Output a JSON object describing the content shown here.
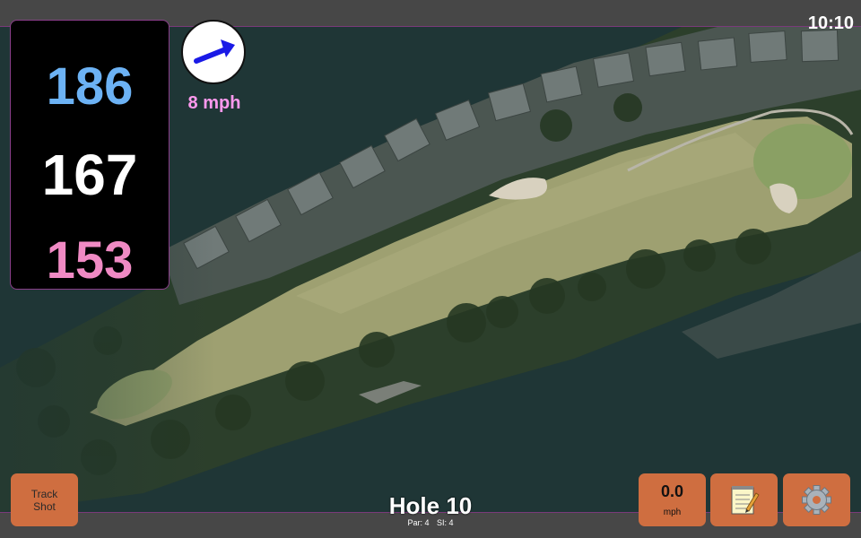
{
  "status_bar": {
    "time": "10:10"
  },
  "distances": {
    "back": "186",
    "center": "167",
    "front": "153"
  },
  "wind": {
    "speed_label": "8 mph",
    "direction": "east-northeast",
    "icon": "wind-arrow-icon"
  },
  "hole": {
    "title": "Hole 10",
    "par_label": "Par: 4",
    "si_label": "SI: 4"
  },
  "buttons": {
    "track_shot_line1": "Track",
    "track_shot_line2": "Shot",
    "speed_value": "0.0",
    "speed_unit": "mph",
    "notes_icon": "notepad-icon",
    "settings_icon": "gear-icon"
  },
  "colors": {
    "back_distance": "#6cb2f4",
    "center_distance": "#ffffff",
    "front_distance": "#f08ac4",
    "wind_label": "#ff99ee",
    "button": "#cf6e40",
    "bar_border": "#7a3a7a"
  }
}
